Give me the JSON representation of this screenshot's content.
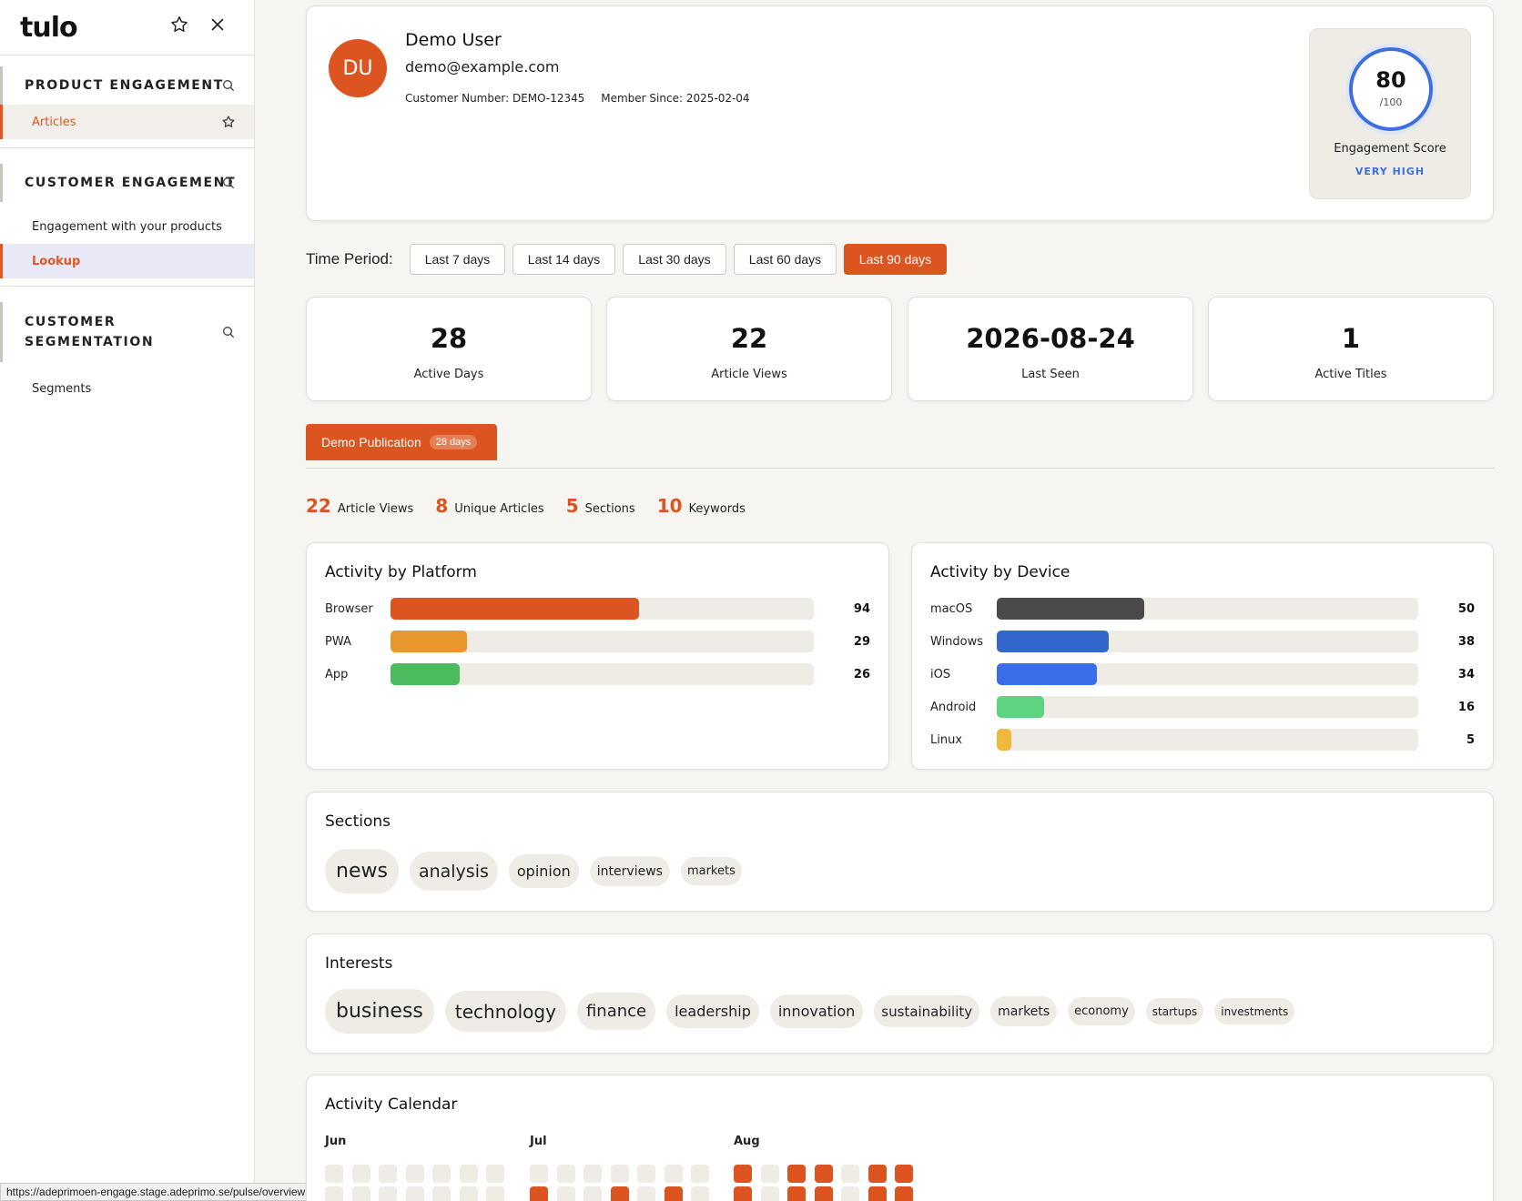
{
  "sidebar": {
    "logo": "tulo",
    "sections": [
      {
        "title": "PRODUCT ENGAGEMENT",
        "items": [
          {
            "label": "Articles"
          }
        ]
      },
      {
        "title": "CUSTOMER ENGAGEMENT",
        "items": [
          {
            "label": "Engagement with your products"
          },
          {
            "label": "Lookup"
          }
        ]
      },
      {
        "title_line1": "CUSTOMER",
        "title_line2": "SEGMENTATION",
        "items": [
          {
            "label": "Segments"
          }
        ]
      }
    ]
  },
  "status_url": "https://adeprimoen-engage.stage.adeprimo.se/pulse/overview",
  "profile": {
    "initials": "DU",
    "name": "Demo User",
    "email": "demo@example.com",
    "customer_number": "Customer Number: DEMO-12345",
    "member_since": "Member Since: 2025-02-04",
    "score": {
      "value": "80",
      "max": "/100",
      "label": "Engagement Score",
      "rating": "VERY HIGH"
    }
  },
  "time_period": {
    "label": "Time Period:",
    "options": [
      "Last 7 days",
      "Last 14 days",
      "Last 30 days",
      "Last 60 days",
      "Last 90 days"
    ],
    "selected": "Last 90 days"
  },
  "stats": [
    {
      "value": "28",
      "label": "Active Days"
    },
    {
      "value": "22",
      "label": "Article Views"
    },
    {
      "value": "2026-08-24",
      "label": "Last Seen"
    },
    {
      "value": "1",
      "label": "Active Titles"
    }
  ],
  "publication": {
    "name": "Demo Publication",
    "badge": "28 days"
  },
  "counts": [
    {
      "n": "22",
      "label": "Article Views"
    },
    {
      "n": "8",
      "label": "Unique Articles"
    },
    {
      "n": "5",
      "label": "Sections"
    },
    {
      "n": "10",
      "label": "Keywords"
    }
  ],
  "platform": {
    "title": "Activity by Platform",
    "max": 100,
    "rows": [
      {
        "name": "Browser",
        "value": 94,
        "color": "#dc5420"
      },
      {
        "name": "PWA",
        "value": 29,
        "color": "#e8972c"
      },
      {
        "name": "App",
        "value": 26,
        "color": "#4cba5e"
      }
    ]
  },
  "device": {
    "title": "Activity by Device",
    "max": 50,
    "rows": [
      {
        "name": "macOS",
        "value": 50,
        "color": "#4a4a4a"
      },
      {
        "name": "Windows",
        "value": 38,
        "color": "#3366cc"
      },
      {
        "name": "iOS",
        "value": 34,
        "color": "#3a6ee8"
      },
      {
        "name": "Android",
        "value": 16,
        "color": "#5ed382"
      },
      {
        "name": "Linux",
        "value": 5,
        "color": "#f0b83c"
      }
    ]
  },
  "sections_card": {
    "title": "Sections",
    "tags": [
      {
        "label": "news",
        "size": 22
      },
      {
        "label": "analysis",
        "size": 19
      },
      {
        "label": "opinion",
        "size": 16
      },
      {
        "label": "interviews",
        "size": 14
      },
      {
        "label": "markets",
        "size": 13
      }
    ]
  },
  "interests_card": {
    "title": "Interests",
    "tags": [
      {
        "label": "business",
        "size": 22
      },
      {
        "label": "technology",
        "size": 20
      },
      {
        "label": "finance",
        "size": 18
      },
      {
        "label": "leadership",
        "size": 16
      },
      {
        "label": "innovation",
        "size": 16
      },
      {
        "label": "sustainability",
        "size": 15
      },
      {
        "label": "markets",
        "size": 14
      },
      {
        "label": "economy",
        "size": 13
      },
      {
        "label": "startups",
        "size": 12
      },
      {
        "label": "investments",
        "size": 12
      }
    ]
  },
  "calendar": {
    "title": "Activity Calendar",
    "months": [
      {
        "label": "Jun",
        "row1": [
          0,
          0,
          0,
          0,
          0,
          0,
          0
        ],
        "row2": [
          0,
          0,
          0,
          0,
          0,
          0,
          0
        ]
      },
      {
        "label": "Jul",
        "row1": [
          0,
          0,
          0,
          0,
          0,
          0,
          0
        ],
        "row2": [
          1,
          0,
          0,
          1,
          0,
          1,
          0
        ]
      },
      {
        "label": "Aug",
        "row1": [
          1,
          0,
          1,
          1,
          0,
          1,
          1
        ],
        "row2": [
          1,
          0,
          1,
          1,
          0,
          1,
          1
        ]
      }
    ]
  }
}
